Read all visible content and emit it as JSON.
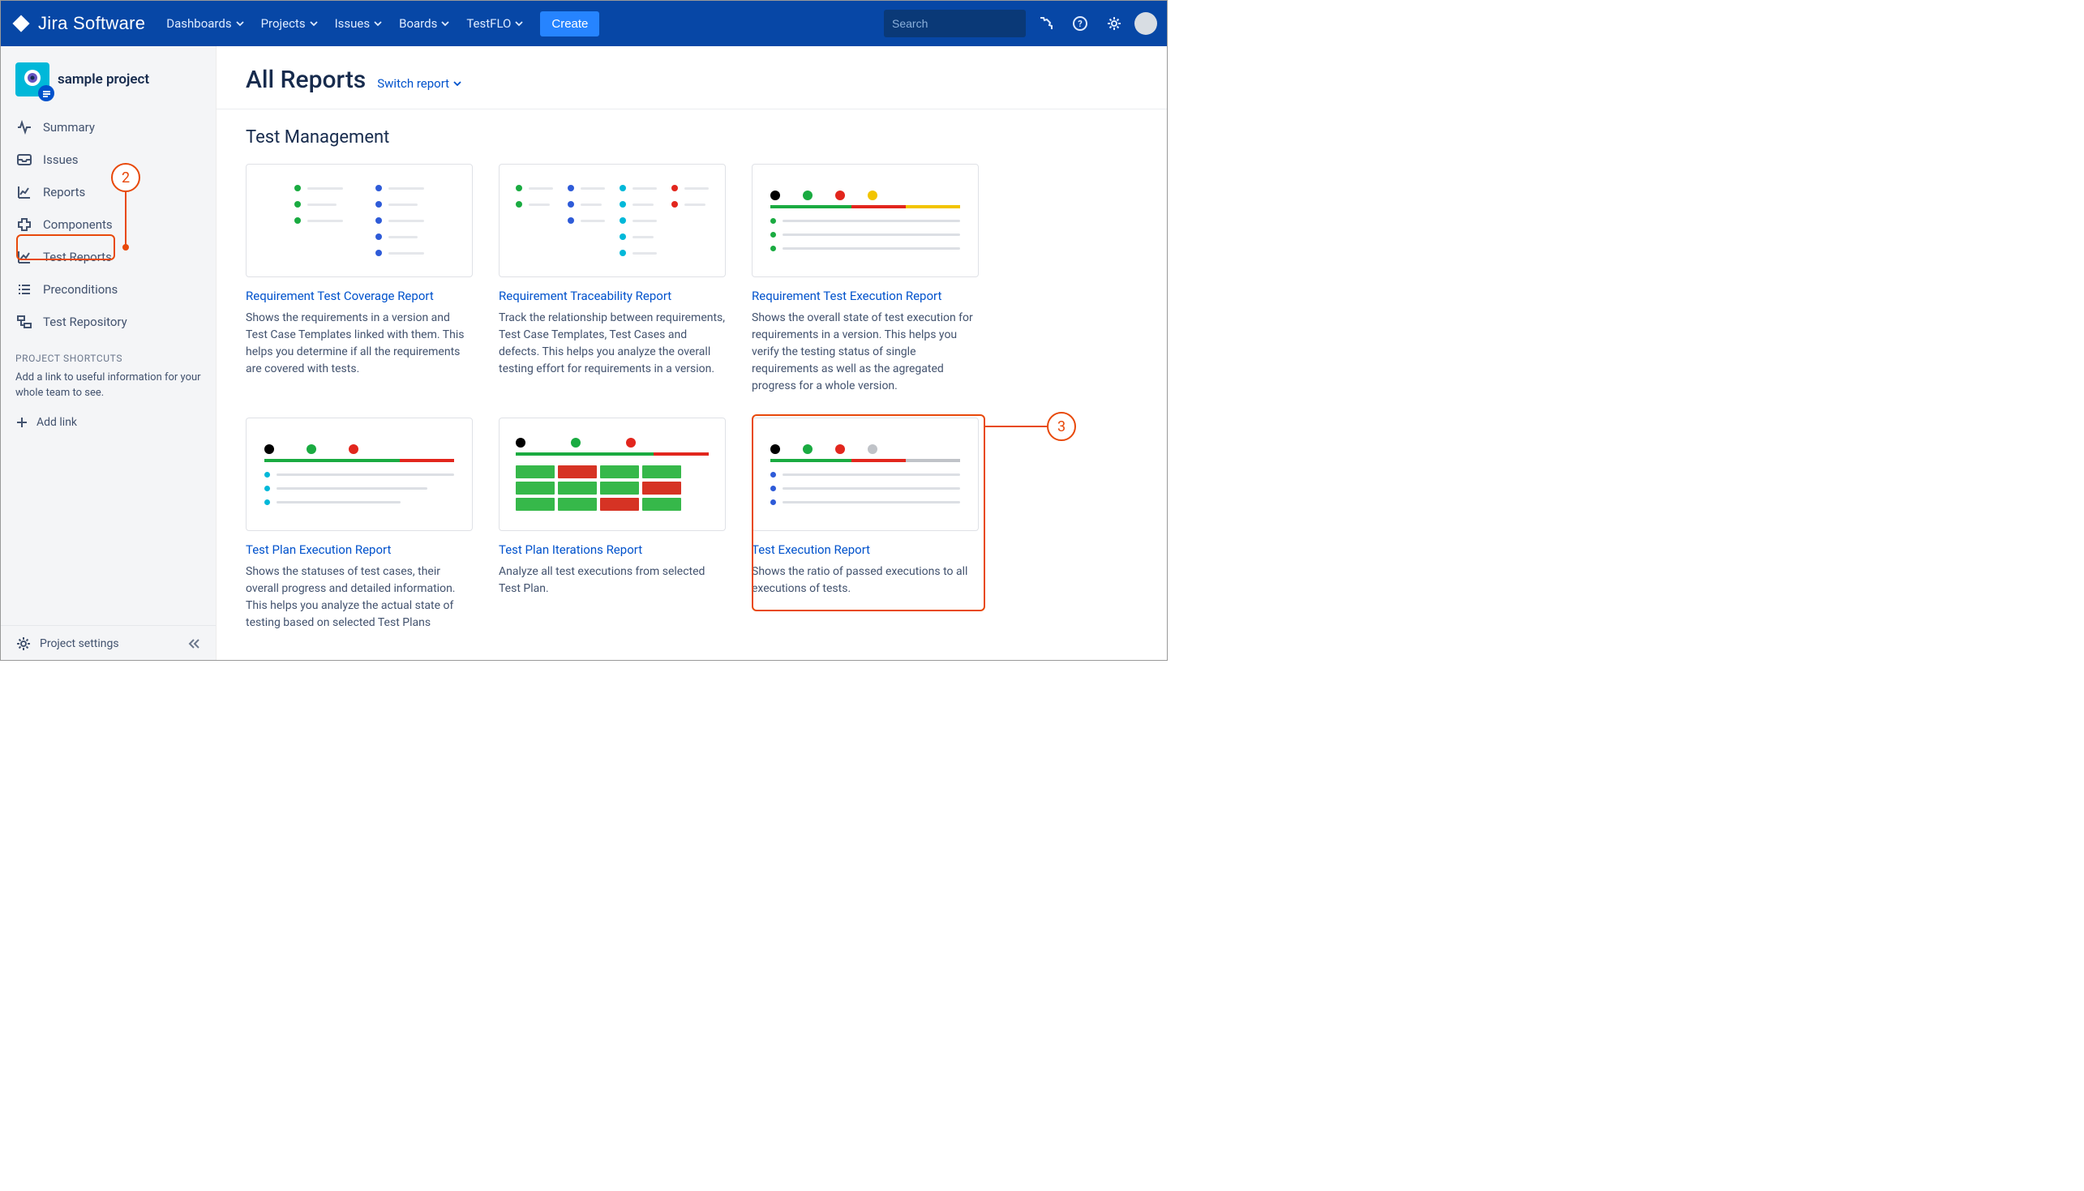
{
  "brand": "Jira Software",
  "nav": {
    "items": [
      "Dashboards",
      "Projects",
      "Issues",
      "Boards",
      "TestFLO"
    ],
    "create": "Create",
    "search_placeholder": "Search"
  },
  "project": {
    "name": "sample project"
  },
  "sidebar": {
    "items": [
      {
        "label": "Summary"
      },
      {
        "label": "Issues"
      },
      {
        "label": "Reports"
      },
      {
        "label": "Components"
      },
      {
        "label": "Test Reports"
      },
      {
        "label": "Preconditions"
      },
      {
        "label": "Test Repository"
      }
    ],
    "shortcuts_label": "PROJECT SHORTCUTS",
    "shortcuts_help": "Add a link to useful information for your whole team to see.",
    "add_link": "Add link",
    "settings": "Project settings"
  },
  "page": {
    "title": "All Reports",
    "switch": "Switch report",
    "section": "Test Management"
  },
  "reports": [
    {
      "title": "Requirement Test Coverage Report",
      "desc": "Shows the requirements in a version and Test Case Templates linked with them. This helps you determine if all the requirements are covered with tests."
    },
    {
      "title": "Requirement Traceability Report",
      "desc": "Track the relationship between requirements, Test Case Templates, Test Cases and defects. This helps you analyze the overall testing effort for requirements in a version."
    },
    {
      "title": "Requirement Test Execution Report",
      "desc": "Shows the overall state of test execution for requirements in a version. This helps you verify the testing status of single requirements as well as the agregated progress for a whole version."
    },
    {
      "title": "Test Plan Execution Report",
      "desc": "Shows the statuses of test cases, their overall progress and detailed information. This helps you analyze the actual state of testing based on selected Test Plans"
    },
    {
      "title": "Test Plan Iterations Report",
      "desc": "Analyze all test executions from selected Test Plan."
    },
    {
      "title": "Test Execution Report",
      "desc": "Shows the ratio of passed executions to all executions of tests."
    }
  ],
  "annotations": {
    "n2": "2",
    "n3": "3"
  }
}
